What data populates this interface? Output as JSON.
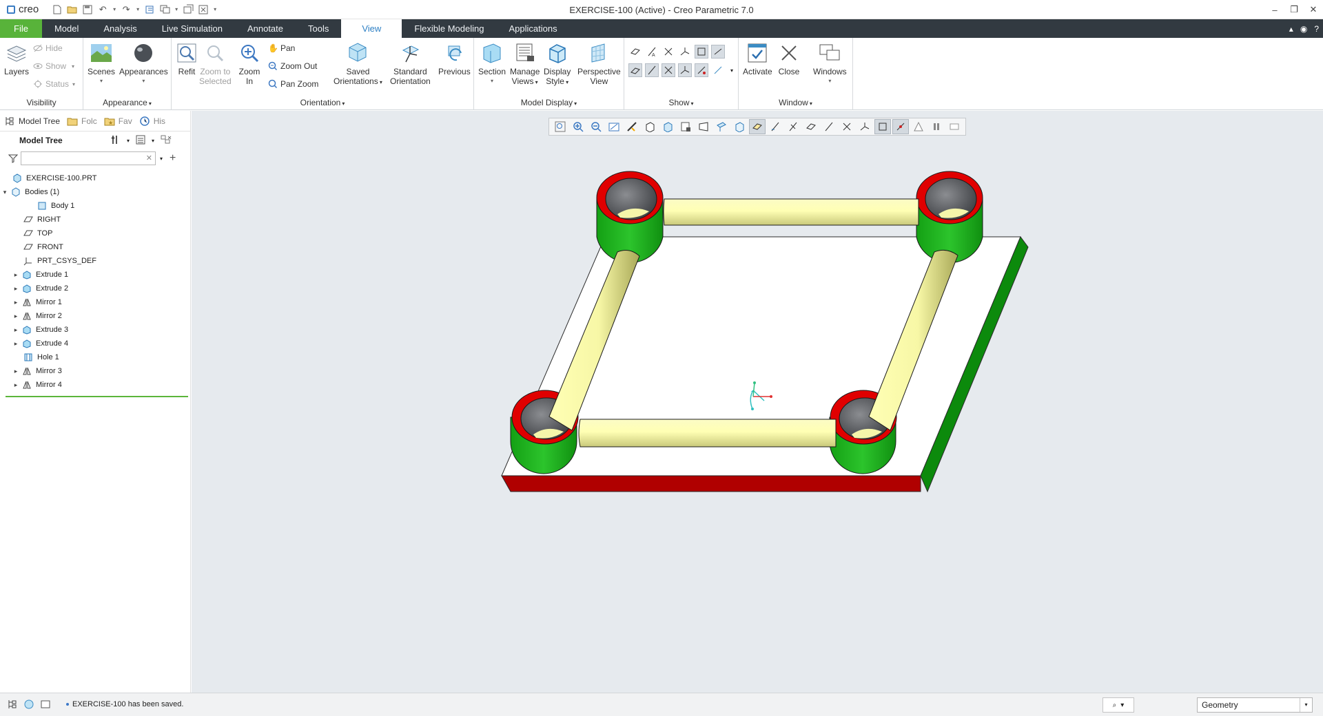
{
  "titlebar": {
    "logo_text": "creo",
    "window_title": "EXERCISE-100 (Active) - Creo Parametric 7.0"
  },
  "tabs": [
    {
      "label": "File"
    },
    {
      "label": "Model"
    },
    {
      "label": "Analysis"
    },
    {
      "label": "Live Simulation"
    },
    {
      "label": "Annotate"
    },
    {
      "label": "Tools"
    },
    {
      "label": "View"
    },
    {
      "label": "Flexible Modeling"
    },
    {
      "label": "Applications"
    }
  ],
  "active_tab": "View",
  "ribbon": {
    "visibility": {
      "group_label": "Visibility",
      "layers": "Layers",
      "hide": "Hide",
      "show": "Show",
      "status": "Status"
    },
    "appearance": {
      "group_label": "Appearance",
      "scenes": "Scenes",
      "appearances": "Appearances"
    },
    "orientation": {
      "group_label": "Orientation",
      "refit": "Refit",
      "zoom_to_selected_1": "Zoom to",
      "zoom_to_selected_2": "Selected",
      "zoom_in_1": "Zoom",
      "zoom_in_2": "In",
      "pan": "Pan",
      "zoom_out": "Zoom Out",
      "pan_zoom": "Pan Zoom",
      "saved_orientations_1": "Saved",
      "saved_orientations_2": "Orientations",
      "standard_orientation_1": "Standard",
      "standard_orientation_2": "Orientation",
      "previous": "Previous"
    },
    "model_display": {
      "group_label": "Model Display",
      "section": "Section",
      "manage_views_1": "Manage",
      "manage_views_2": "Views",
      "display_style_1": "Display",
      "display_style_2": "Style",
      "perspective_view_1": "Perspective",
      "perspective_view_2": "View"
    },
    "show": {
      "group_label": "Show"
    },
    "window": {
      "group_label": "Window",
      "activate": "Activate",
      "close": "Close",
      "windows": "Windows"
    }
  },
  "left_panel": {
    "nav_tabs": [
      "Model Tree",
      "Folc",
      "Fav",
      "His"
    ],
    "tree_title": "Model Tree",
    "search_placeholder": "",
    "tree_items": [
      {
        "label": "EXERCISE-100.PRT",
        "icon": "part-icon"
      },
      {
        "label": "Bodies (1)",
        "icon": "bodies-icon"
      },
      {
        "label": "Body 1",
        "icon": "body-icon"
      },
      {
        "label": "RIGHT",
        "icon": "datum-plane-icon"
      },
      {
        "label": "TOP",
        "icon": "datum-plane-icon"
      },
      {
        "label": "FRONT",
        "icon": "datum-plane-icon"
      },
      {
        "label": "PRT_CSYS_DEF",
        "icon": "csys-icon"
      },
      {
        "label": "Extrude 1",
        "icon": "extrude-icon"
      },
      {
        "label": "Extrude 2",
        "icon": "extrude-icon"
      },
      {
        "label": "Mirror 1",
        "icon": "mirror-icon"
      },
      {
        "label": "Mirror 2",
        "icon": "mirror-icon"
      },
      {
        "label": "Extrude 3",
        "icon": "extrude-icon"
      },
      {
        "label": "Extrude 4",
        "icon": "extrude-icon"
      },
      {
        "label": "Hole 1",
        "icon": "hole-icon"
      },
      {
        "label": "Mirror 3",
        "icon": "mirror-icon"
      },
      {
        "label": "Mirror 4",
        "icon": "mirror-icon"
      }
    ]
  },
  "status": {
    "message": "EXERCISE-100 has been saved.",
    "filter_value": "Geometry"
  },
  "colors": {
    "file_tab": "#58b33a",
    "tab_bar": "#323a41",
    "active_tab_text": "#2d7fc4",
    "graphics_bg": "#e6eaee",
    "boss_green": "#1fae1f",
    "ring_red": "#e00000",
    "rail_yellow": "#ffffa6",
    "plate_white": "#ffffff",
    "plate_front": "#b00000",
    "plate_side": "#0c8a0c"
  }
}
